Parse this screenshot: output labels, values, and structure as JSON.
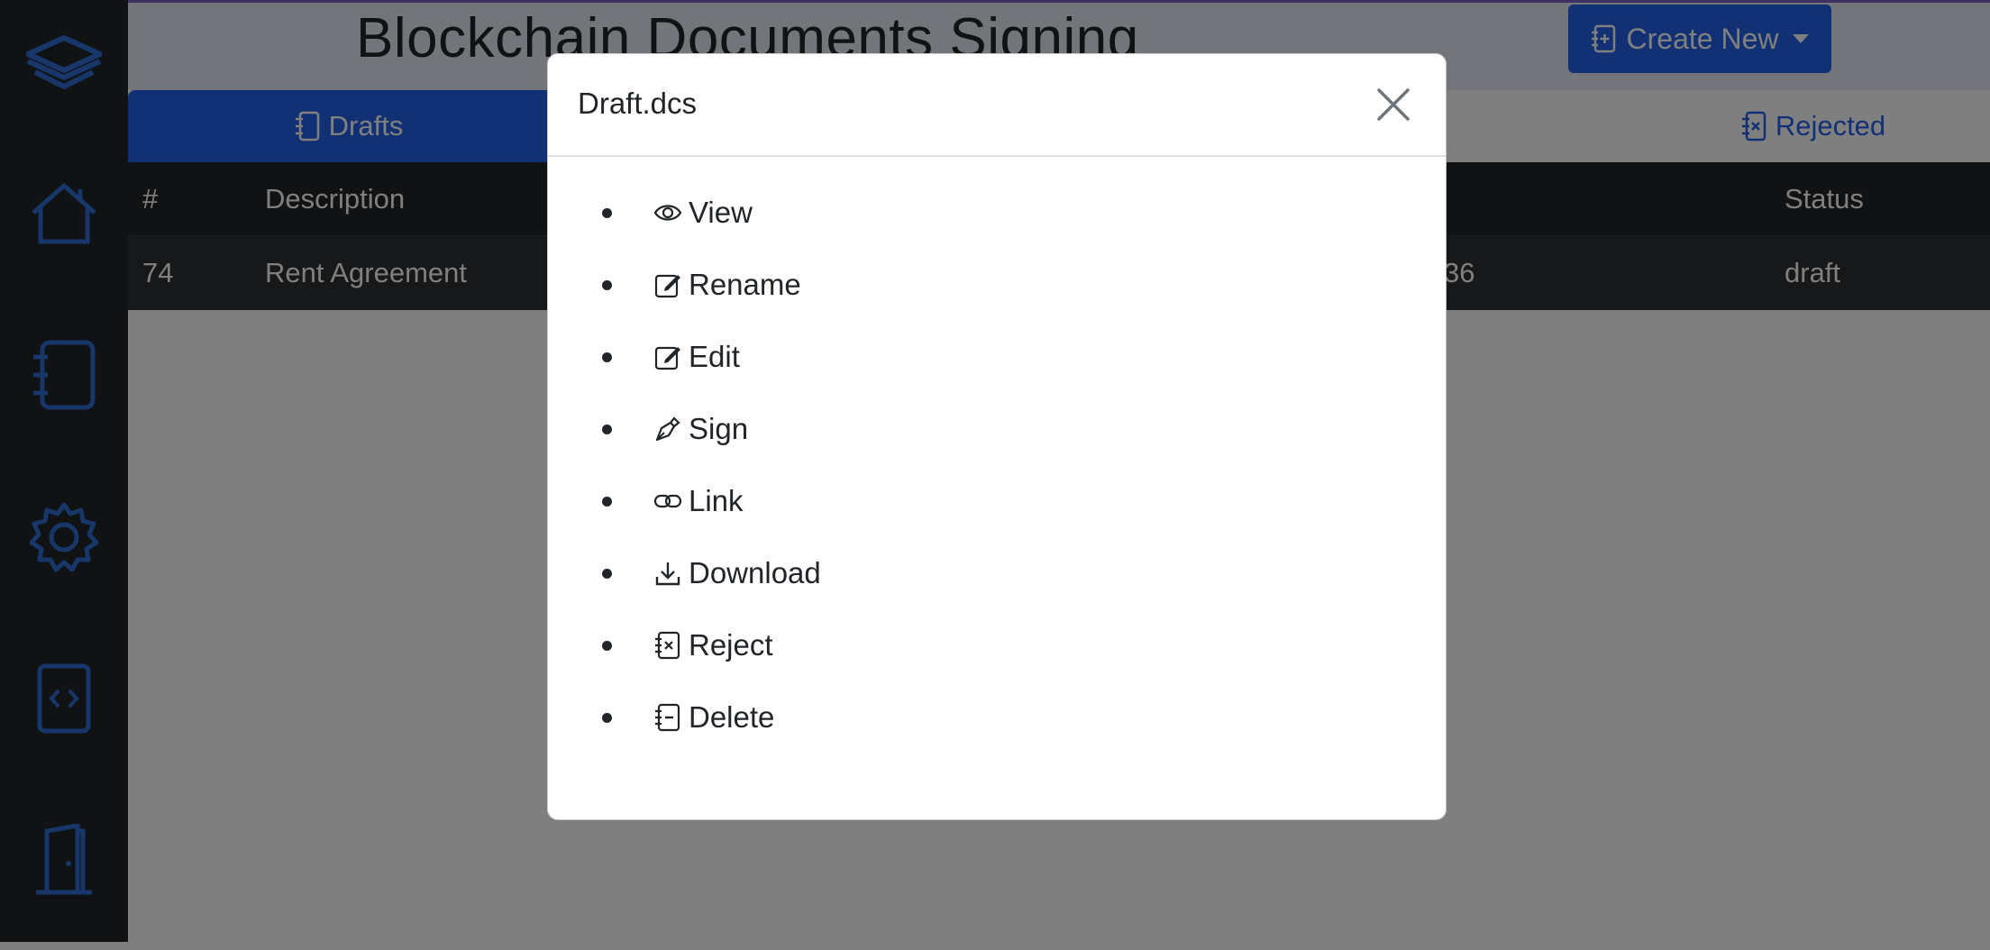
{
  "header": {
    "title": "Blockchain Documents Signing",
    "create_button": "Create New"
  },
  "tabs": [
    {
      "label": "Drafts",
      "active": true
    },
    {
      "label": "Rejected",
      "active": false
    }
  ],
  "table": {
    "columns": [
      "#",
      "Description",
      "Status"
    ],
    "rows": [
      {
        "id": "74",
        "description": "Rent Agreement",
        "partial": "36",
        "status": "draft"
      }
    ]
  },
  "sidebar": {
    "icons": [
      "logo-icon",
      "home-icon",
      "notebook-icon",
      "gear-icon",
      "code-icon",
      "door-exit-icon"
    ]
  },
  "modal": {
    "title": "Draft.dcs",
    "items": [
      {
        "label": "View",
        "icon": "eye-icon"
      },
      {
        "label": "Rename",
        "icon": "pencil-square-icon"
      },
      {
        "label": "Edit",
        "icon": "pencil-square-icon"
      },
      {
        "label": "Sign",
        "icon": "pen-nib-icon"
      },
      {
        "label": "Link",
        "icon": "link-icon"
      },
      {
        "label": "Download",
        "icon": "download-icon"
      },
      {
        "label": "Reject",
        "icon": "journal-x-icon"
      },
      {
        "label": "Delete",
        "icon": "journal-minus-icon"
      }
    ]
  },
  "colors": {
    "accent": "#2563eb",
    "sidebar": "#212529",
    "table_row": "#2c3034"
  }
}
